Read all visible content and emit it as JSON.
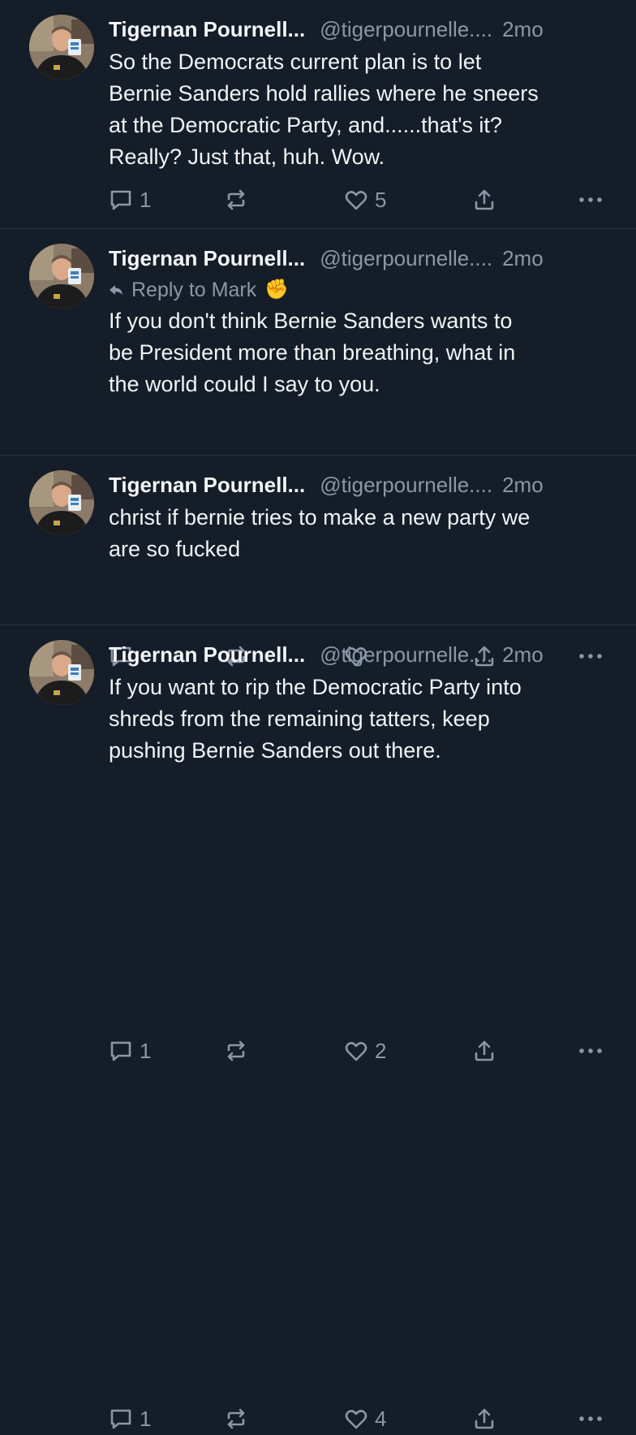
{
  "posts": [
    {
      "author": "Tigernan Pournell...",
      "handle": "@tigerpournelle....",
      "time": "2mo",
      "reply_to": "",
      "text_lines": [
        "So the Democrats current plan is to let",
        "Bernie Sanders hold rallies where he sneers",
        "at the Democratic Party, and......that's it?",
        "Really? Just that, huh. Wow."
      ],
      "replies": "1",
      "reposts": "",
      "likes": "5"
    },
    {
      "author": "Tigernan Pournell...",
      "handle": "@tigerpournelle....",
      "time": "2mo",
      "reply_to": "Reply to Mark",
      "reply_emoji": "✊",
      "text_lines": [
        "If you don't think Bernie Sanders wants to",
        "be President more than breathing, what in",
        "the world could I say to you."
      ],
      "replies": "",
      "reposts": "",
      "likes": ""
    },
    {
      "author": "Tigernan Pournell...",
      "handle": "@tigerpournelle....",
      "time": "2mo",
      "reply_to": "",
      "text_lines": [
        "christ if bernie tries to make a new party we",
        "are so fucked"
      ],
      "replies": "1",
      "reposts": "",
      "likes": "2"
    },
    {
      "author": "Tigernan Pournell...",
      "handle": "@tigerpournelle....",
      "time": "2mo",
      "reply_to": "",
      "text_lines": [
        "If you want to rip the Democratic Party into",
        "shreds from the remaining tatters, keep",
        "pushing Bernie Sanders out there."
      ],
      "replies": "1",
      "reposts": "",
      "likes": "4"
    }
  ],
  "icons": {
    "reply": "speech-bubble-icon",
    "repost": "repost-arrows-icon",
    "like": "heart-icon",
    "share": "share-upload-icon",
    "more": "ellipsis-icon",
    "reply_arrow": "reply-arrow-icon"
  },
  "colors": {
    "background": "#151d28",
    "text": "#f1f3f5",
    "muted": "#8a97a6",
    "divider": "#2a3441"
  }
}
